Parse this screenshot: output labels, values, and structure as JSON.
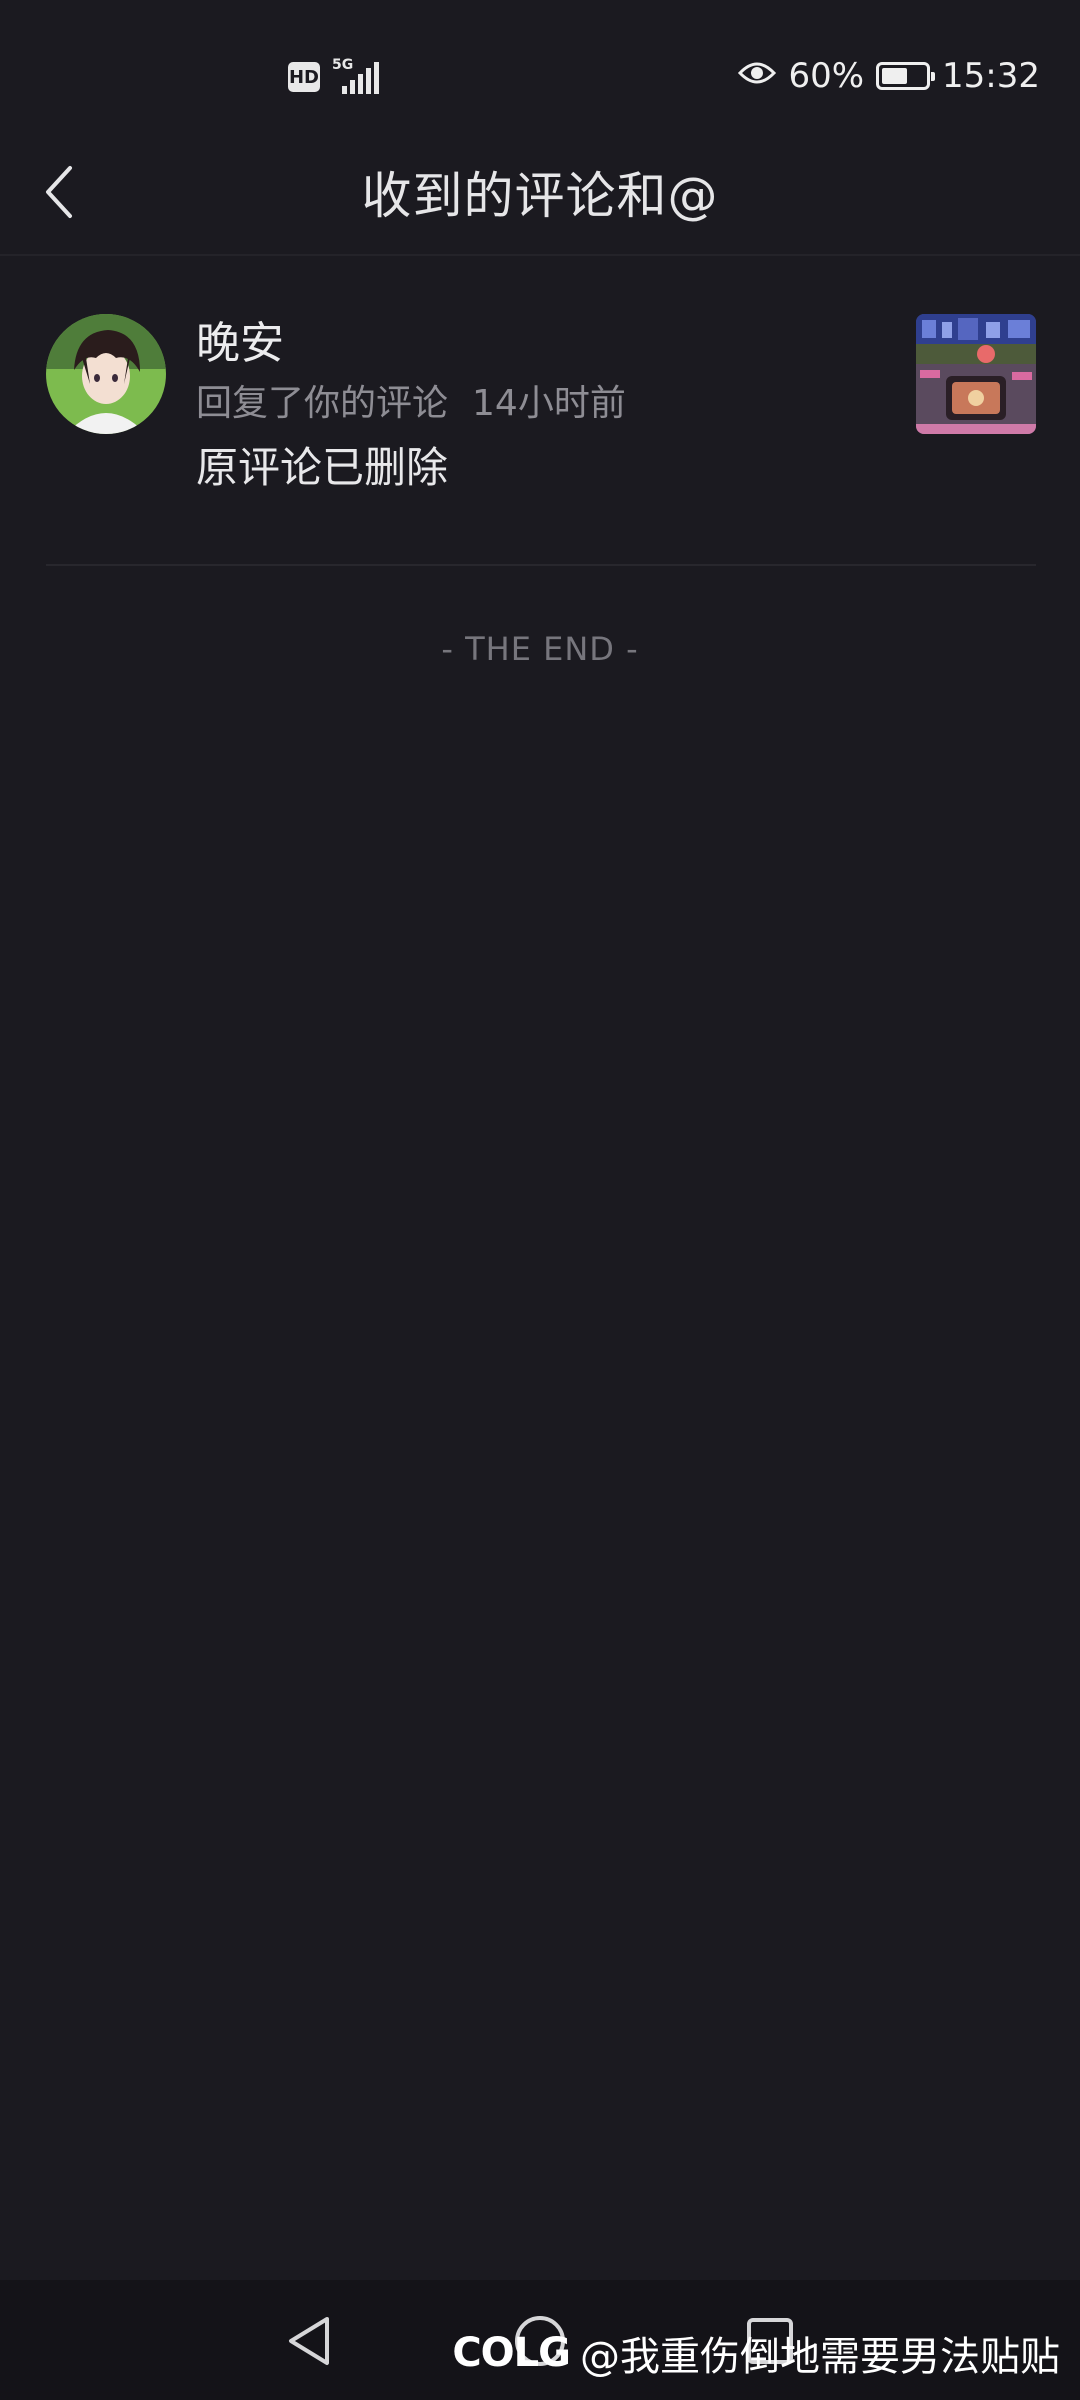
{
  "status_bar": {
    "hd_label": "HD",
    "network_label": "5G",
    "battery_percent": "60%",
    "battery_level": 0.6,
    "time": "15:32"
  },
  "header": {
    "title": "收到的评论和@"
  },
  "notifications": [
    {
      "username": "晚安",
      "action": "回复了你的评论",
      "time": "14小时前",
      "comment": "原评论已删除"
    }
  ],
  "list_end_text": "- THE END -",
  "watermark": {
    "logo": "COLG",
    "text": "@我重伤倒地需要男法贴贴"
  },
  "colors": {
    "background": "#1b1a20",
    "nav_background": "#141318",
    "primary_text": "#e6e6e8",
    "secondary_text": "#8e8d94"
  }
}
